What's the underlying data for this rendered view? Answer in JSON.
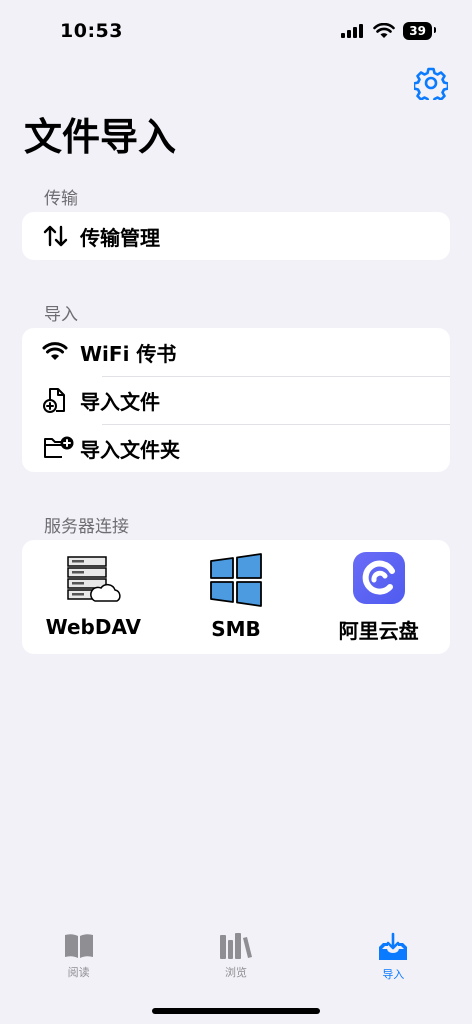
{
  "status": {
    "time": "10:53",
    "battery": "39"
  },
  "page": {
    "title": "文件导入"
  },
  "sections": {
    "transfer": {
      "header": "传输",
      "item": "传输管理"
    },
    "import": {
      "header": "导入",
      "wifi": "WiFi 传书",
      "file": "导入文件",
      "folder": "导入文件夹"
    },
    "server": {
      "header": "服务器连接",
      "webdav": "WebDAV",
      "smb": "SMB",
      "aliyun": "阿里云盘"
    }
  },
  "tabs": {
    "read": "阅读",
    "browse": "浏览",
    "import": "导入"
  },
  "colors": {
    "accent": "#0A7AFF",
    "background": "#F2F1F7",
    "card": "#FFFFFF",
    "muted": "#6D6D72"
  }
}
